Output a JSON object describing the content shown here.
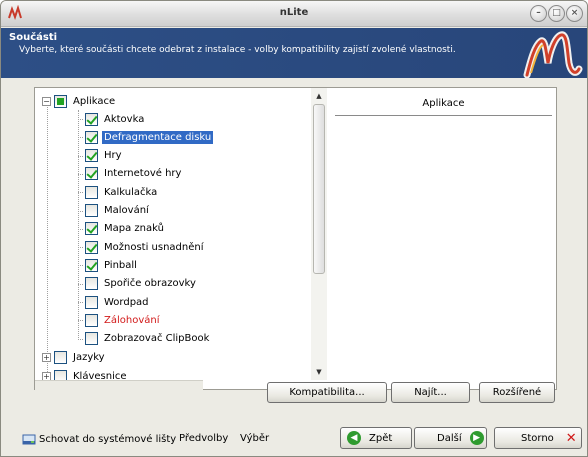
{
  "window": {
    "title": "nLite"
  },
  "header": {
    "title": "Součásti",
    "subtitle": "Vyberte, které součásti chcete odebrat z instalace - volby kompatibility zajistí zvolené vlastnosti."
  },
  "tree": {
    "root": {
      "label": "Aplikace",
      "state": "partial",
      "expanded": true
    },
    "items": [
      {
        "label": "Aktovka",
        "checked": true,
        "selected": false,
        "red": false
      },
      {
        "label": "Defragmentace disku",
        "checked": true,
        "selected": true,
        "red": false
      },
      {
        "label": "Hry",
        "checked": true,
        "selected": false,
        "red": false
      },
      {
        "label": "Internetové hry",
        "checked": true,
        "selected": false,
        "red": false
      },
      {
        "label": "Kalkulačka",
        "checked": false,
        "selected": false,
        "red": false
      },
      {
        "label": "Malování",
        "checked": false,
        "selected": false,
        "red": false
      },
      {
        "label": "Mapa znaků",
        "checked": true,
        "selected": false,
        "red": false
      },
      {
        "label": "Možnosti usnadnění",
        "checked": true,
        "selected": false,
        "red": false
      },
      {
        "label": "Pinball",
        "checked": true,
        "selected": false,
        "red": false
      },
      {
        "label": "Spořiče obrazovky",
        "checked": false,
        "selected": false,
        "red": false
      },
      {
        "label": "Wordpad",
        "checked": false,
        "selected": false,
        "red": false
      },
      {
        "label": "Zálohování",
        "checked": false,
        "selected": false,
        "red": true
      },
      {
        "label": "Zobrazovač ClipBook",
        "checked": false,
        "selected": false,
        "red": false
      }
    ],
    "groups": [
      {
        "label": "Jazyky"
      },
      {
        "label": "Klávesnice"
      }
    ]
  },
  "description": {
    "title": "Aplikace"
  },
  "buttons": {
    "compat": "Kompatibilita...",
    "find": "Najít...",
    "advanced": "Rozšířené"
  },
  "footer": {
    "tray": "Schovat do systémové lišty",
    "presets": "Předvolby",
    "select": "Výběr",
    "back": "Zpět",
    "next": "Další",
    "cancel": "Storno"
  },
  "colors": {
    "header_bg": "#2d4f86",
    "selection": "#316ac5",
    "check": "#22a322",
    "warning_text": "#d21a1a"
  }
}
